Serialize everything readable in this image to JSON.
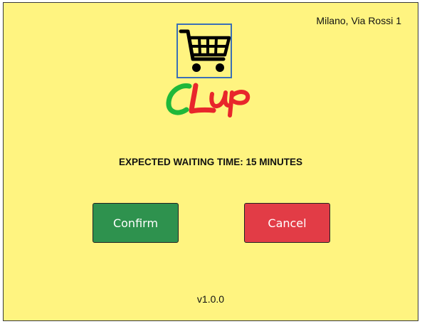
{
  "header": {
    "location": "Milano, Via Rossi 1"
  },
  "logo": {
    "icon": "shopping-cart-icon",
    "wordmark": "CLup",
    "colors": {
      "c": "#1fb83a",
      "l": "#e8262b",
      "up": "#e8262b"
    }
  },
  "main": {
    "waiting_text": "EXPECTED WAITING TIME: 15 MINUTES"
  },
  "actions": {
    "confirm_label": "Confirm",
    "cancel_label": "Cancel",
    "confirm_color": "#2e924e",
    "cancel_color": "#e23c46"
  },
  "footer": {
    "version": "v1.0.0"
  },
  "theme": {
    "background": "#fff480",
    "border": "#3a3a3a",
    "logo_border": "#3b6fb6"
  }
}
